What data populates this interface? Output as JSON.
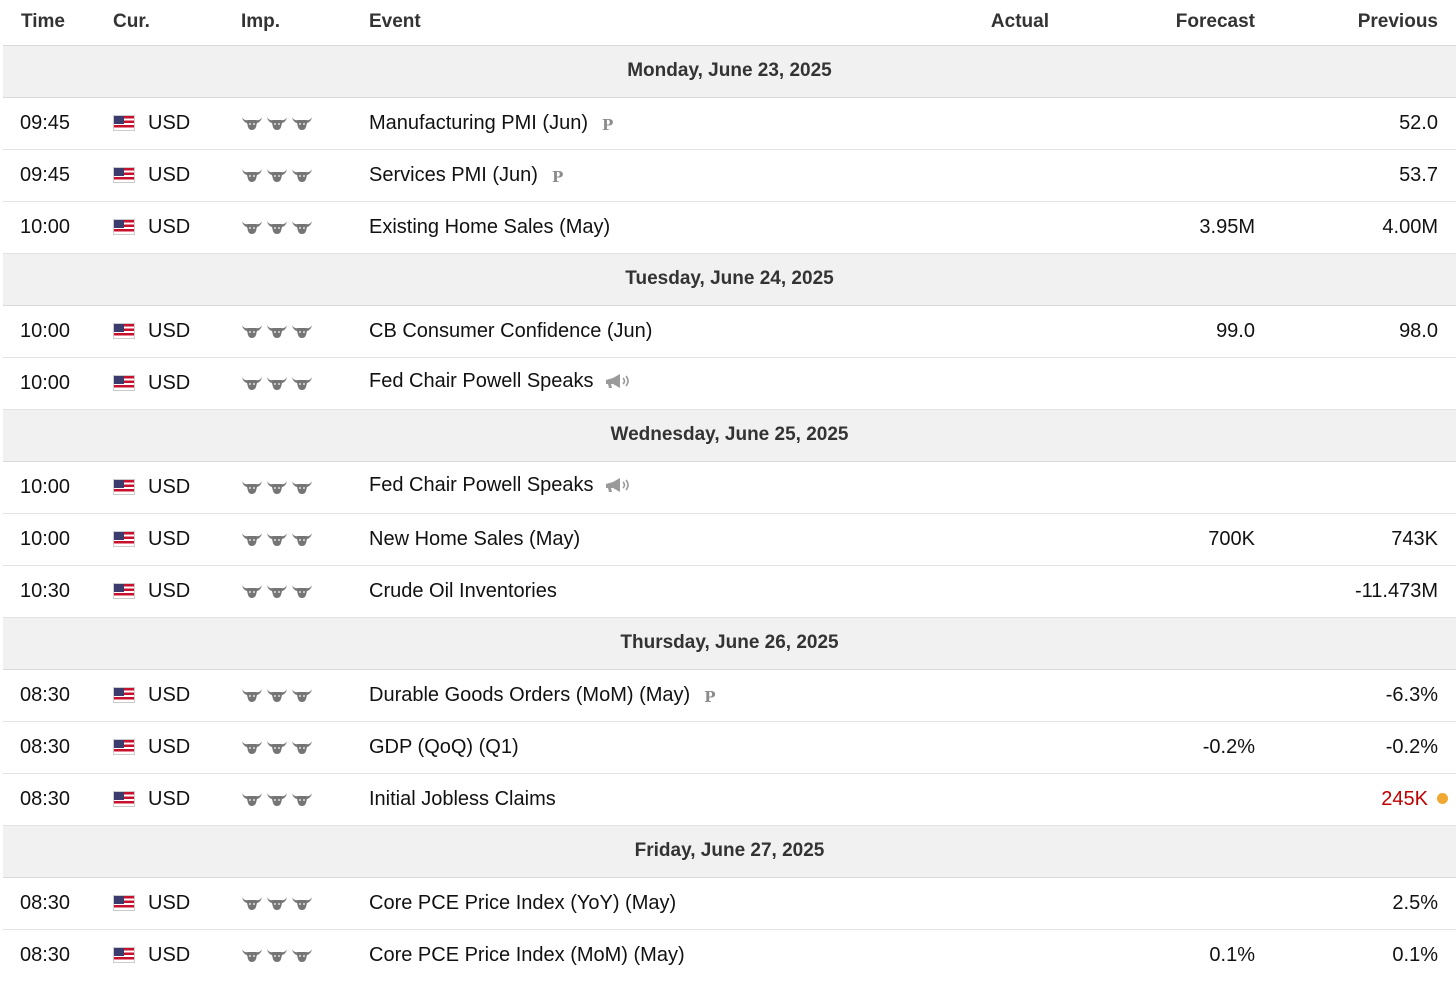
{
  "headers": {
    "time": "Time",
    "cur": "Cur.",
    "imp": "Imp.",
    "event": "Event",
    "actual": "Actual",
    "forecast": "Forecast",
    "previous": "Previous"
  },
  "days": [
    {
      "date": "Monday, June 23, 2025",
      "events": [
        {
          "time": "09:45",
          "currency": "USD",
          "event": "Manufacturing PMI (Jun)",
          "marker": "P",
          "actual": "",
          "forecast": "",
          "previous": "52.0"
        },
        {
          "time": "09:45",
          "currency": "USD",
          "event": "Services PMI (Jun)",
          "marker": "P",
          "actual": "",
          "forecast": "",
          "previous": "53.7"
        },
        {
          "time": "10:00",
          "currency": "USD",
          "event": "Existing Home Sales (May)",
          "marker": "",
          "actual": "",
          "forecast": "3.95M",
          "previous": "4.00M"
        }
      ]
    },
    {
      "date": "Tuesday, June 24, 2025",
      "events": [
        {
          "time": "10:00",
          "currency": "USD",
          "event": "CB Consumer Confidence (Jun)",
          "marker": "",
          "actual": "",
          "forecast": "99.0",
          "previous": "98.0"
        },
        {
          "time": "10:00",
          "currency": "USD",
          "event": "Fed Chair Powell Speaks",
          "marker": "speech",
          "actual": "",
          "forecast": "",
          "previous": ""
        }
      ]
    },
    {
      "date": "Wednesday, June 25, 2025",
      "events": [
        {
          "time": "10:00",
          "currency": "USD",
          "event": "Fed Chair Powell Speaks",
          "marker": "speech",
          "actual": "",
          "forecast": "",
          "previous": ""
        },
        {
          "time": "10:00",
          "currency": "USD",
          "event": "New Home Sales (May)",
          "marker": "",
          "actual": "",
          "forecast": "700K",
          "previous": "743K"
        },
        {
          "time": "10:30",
          "currency": "USD",
          "event": "Crude Oil Inventories",
          "marker": "",
          "actual": "",
          "forecast": "",
          "previous": "-11.473M"
        }
      ]
    },
    {
      "date": "Thursday, June 26, 2025",
      "events": [
        {
          "time": "08:30",
          "currency": "USD",
          "event": "Durable Goods Orders (MoM) (May)",
          "marker": "P",
          "actual": "",
          "forecast": "",
          "previous": "-6.3%"
        },
        {
          "time": "08:30",
          "currency": "USD",
          "event": "GDP (QoQ) (Q1)",
          "marker": "",
          "actual": "",
          "forecast": "-0.2%",
          "previous": "-0.2%"
        },
        {
          "time": "08:30",
          "currency": "USD",
          "event": "Initial Jobless Claims",
          "marker": "",
          "actual": "",
          "forecast": "",
          "previous": "245K",
          "previous_color": "#c00000",
          "previous_dot": "#f0a830"
        }
      ]
    },
    {
      "date": "Friday, June 27, 2025",
      "events": [
        {
          "time": "08:30",
          "currency": "USD",
          "event": "Core PCE Price Index (YoY) (May)",
          "marker": "",
          "actual": "",
          "forecast": "",
          "previous": "2.5%"
        },
        {
          "time": "08:30",
          "currency": "USD",
          "event": "Core PCE Price Index (MoM) (May)",
          "marker": "",
          "actual": "",
          "forecast": "0.1%",
          "previous": "0.1%"
        }
      ]
    }
  ],
  "importance_icon": "bull-icon",
  "importance_level": 3,
  "flag_icon": "us-flag-icon"
}
